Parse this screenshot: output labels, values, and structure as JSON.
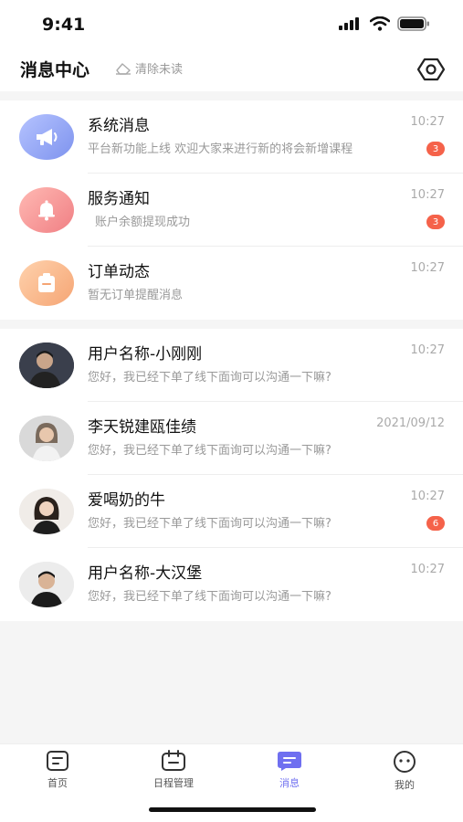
{
  "status_bar": {
    "time": "9:41"
  },
  "header": {
    "title": "消息中心",
    "clear_unread": "清除未读"
  },
  "system_messages": [
    {
      "title": "系统消息",
      "preview": "平台新功能上线 欢迎大家来进行新的将会新增课程",
      "time": "10:27",
      "badge": "3",
      "icon": "megaphone-icon",
      "color": "#8ea2f5"
    },
    {
      "title": "服务通知",
      "preview": "账户余额提现成功",
      "time": "10:27",
      "badge": "3",
      "icon": "bell-icon",
      "color": "#f28b8b"
    },
    {
      "title": "订单动态",
      "preview": "暂无订单提醒消息",
      "time": "10:27",
      "badge": "",
      "icon": "order-icon",
      "color": "#f6b27f"
    }
  ],
  "chats": [
    {
      "name": "用户名称-小刚刚",
      "preview": "您好，我已经下单了线下面询可以沟通一下嘛?",
      "time": "10:27",
      "badge": ""
    },
    {
      "name": "李天锐建瓯佳绩",
      "preview": "您好，我已经下单了线下面询可以沟通一下嘛?",
      "time": "2021/09/12",
      "badge": ""
    },
    {
      "name": "爱喝奶的牛",
      "preview": "您好，我已经下单了线下面询可以沟通一下嘛?",
      "time": "10:27",
      "badge": "6"
    },
    {
      "name": "用户名称-大汉堡",
      "preview": "您好，我已经下单了线下面询可以沟通一下嘛?",
      "time": "10:27",
      "badge": ""
    }
  ],
  "tabbar": {
    "tabs": [
      {
        "label": "首页",
        "icon": "home-icon"
      },
      {
        "label": "日程管理",
        "icon": "calendar-icon"
      },
      {
        "label": "消息",
        "icon": "message-icon"
      },
      {
        "label": "我的",
        "icon": "profile-icon"
      }
    ],
    "active": "消息"
  },
  "colors": {
    "accent": "#6f6ff0",
    "badge": "#f5624a"
  }
}
